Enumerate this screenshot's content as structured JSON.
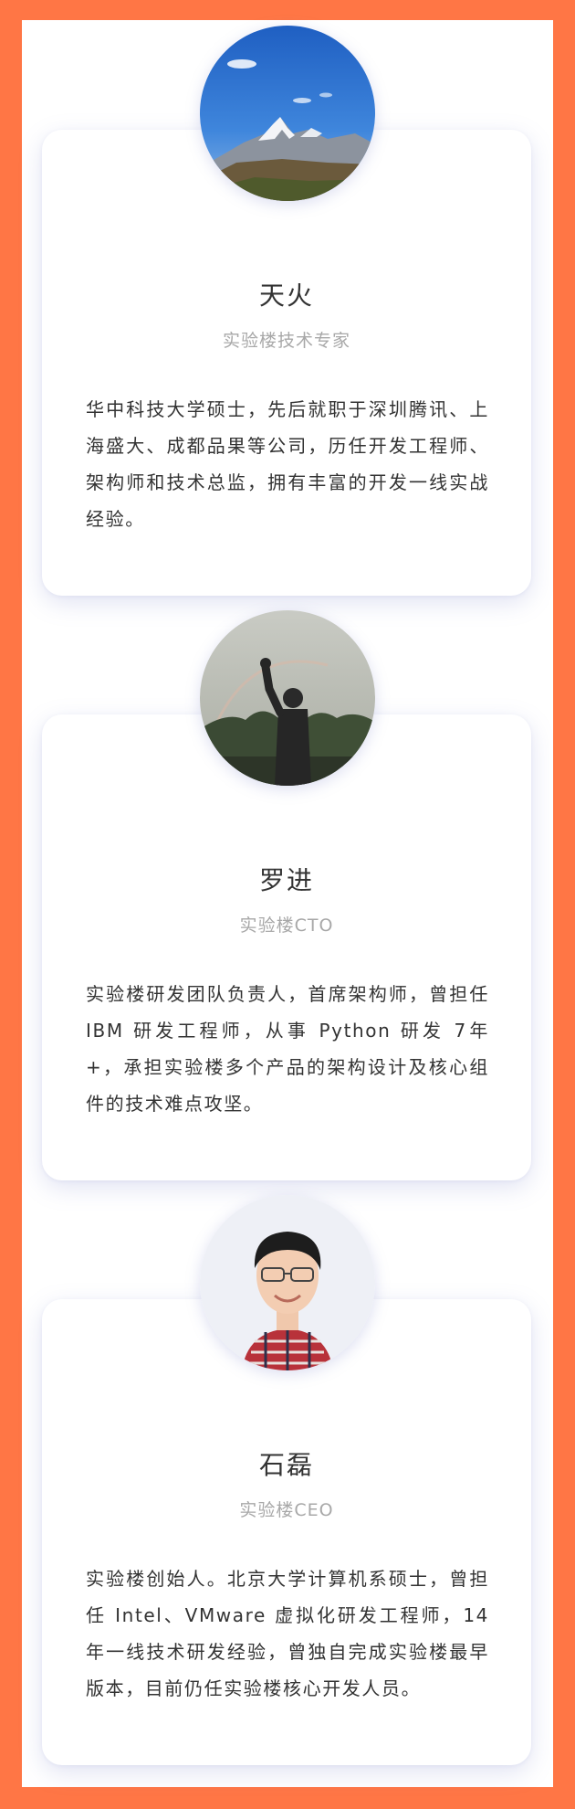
{
  "colors": {
    "frame": "#ff7645",
    "card": "#ffffff",
    "name": "#333333",
    "role": "#a8a8a8",
    "bio": "#333333"
  },
  "members": [
    {
      "avatar_icon": "snow-mountain-photo",
      "name": "天火",
      "title": "实验楼技术专家",
      "bio": "华中科技大学硕士，先后就职于深圳腾讯、上海盛大、成都品果等公司，历任开发工程师、架构师和技术总监，拥有丰富的开发一线实战经验。"
    },
    {
      "avatar_icon": "silhouette-fist-photo",
      "name": "罗进",
      "title": "实验楼CTO",
      "bio": "实验楼研发团队负责人，首席架构师，曾担任 IBM 研发工程师，从事 Python 研发 7年+，承担实验楼多个产品的架构设计及核心组件的技术难点攻坚。"
    },
    {
      "avatar_icon": "portrait-glasses-photo",
      "name": "石磊",
      "title": "实验楼CEO",
      "bio": "实验楼创始人。北京大学计算机系硕士，曾担任 Intel、VMware 虚拟化研发工程师，14年一线技术研发经验，曾独自完成实验楼最早版本，目前仍任实验楼核心开发人员。"
    }
  ]
}
